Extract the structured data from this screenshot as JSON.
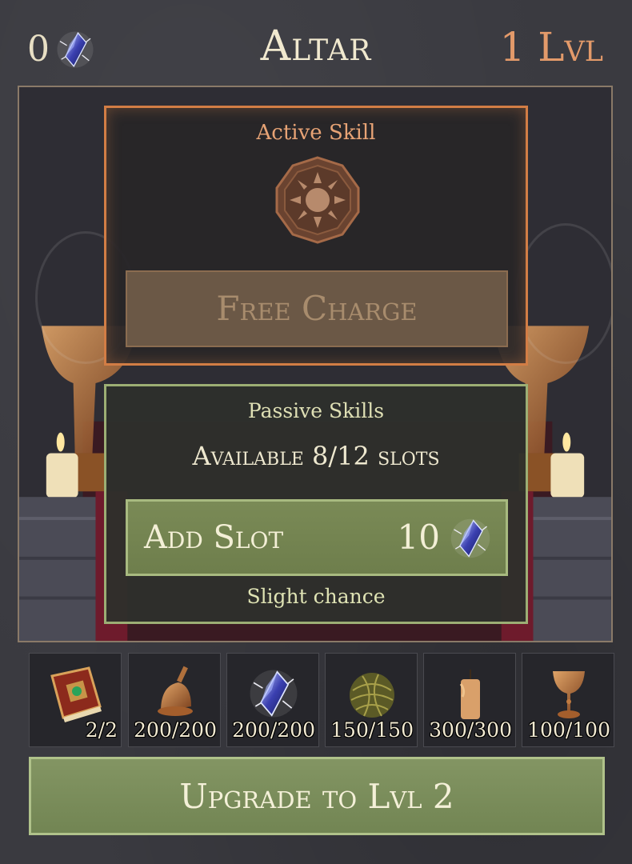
{
  "header": {
    "crystal_count": "0",
    "title": "Altar",
    "level": "1 Lvl",
    "crystal_icon": "crystal-icon"
  },
  "active": {
    "heading": "Active Skill",
    "skill_icon": "sun-skill-icon",
    "button_label": "Free Charge"
  },
  "passive": {
    "heading": "Passive Skills",
    "available": "Available 8/12 slots",
    "add_slot_label": "Add Slot",
    "add_slot_cost": "10",
    "chance": "Slight chance"
  },
  "resources": [
    {
      "icon": "book-icon",
      "count": "2/2"
    },
    {
      "icon": "bell-icon",
      "count": "200/200"
    },
    {
      "icon": "crystal-icon",
      "count": "200/200"
    },
    {
      "icon": "herb-ball-icon",
      "count": "150/150"
    },
    {
      "icon": "candle-icon",
      "count": "300/300"
    },
    {
      "icon": "chalice-icon",
      "count": "100/100"
    }
  ],
  "upgrade": {
    "label": "Upgrade to Lvl 2"
  },
  "colors": {
    "active_accent": "#d27d45",
    "passive_accent": "#9cae74",
    "level_color": "#e39a6a"
  }
}
